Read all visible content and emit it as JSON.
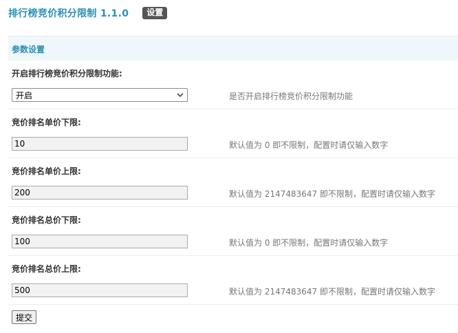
{
  "header": {
    "plugin_title": "排行榜竞价积分限制 1.1.0",
    "settings_tab": "设置"
  },
  "section": {
    "title": "参数设置"
  },
  "fields": [
    {
      "label": "开启排行榜竞价积分限制功能:",
      "type": "select",
      "value": "开启",
      "hint": "是否开启排行榜竞价积分限制功能"
    },
    {
      "label": "竞价排名单价下限:",
      "type": "text",
      "value": "10",
      "hint": "默认值为 0 即不限制，配置时请仅输入数字"
    },
    {
      "label": "竞价排名单价上限:",
      "type": "text",
      "value": "200",
      "hint": "默认值为 2147483647 即不限制，配置时请仅输入数字"
    },
    {
      "label": "竞价排名总价下限:",
      "type": "text",
      "value": "100",
      "hint": "默认值为 0 即不限制，配置时请仅输入数字"
    },
    {
      "label": "竞价排名总价上限:",
      "type": "text",
      "value": "500",
      "hint": "默认值为 2147483647 即不限制，配置时请仅输入数字"
    }
  ],
  "submit": {
    "label": "提交"
  },
  "colors": {
    "accent": "#2b8fb5",
    "section_bg": "#f0f7fb",
    "tab_bg": "#555555",
    "hint_text": "#777777"
  },
  "icons": {
    "select_arrow": "chevron-down-icon"
  }
}
